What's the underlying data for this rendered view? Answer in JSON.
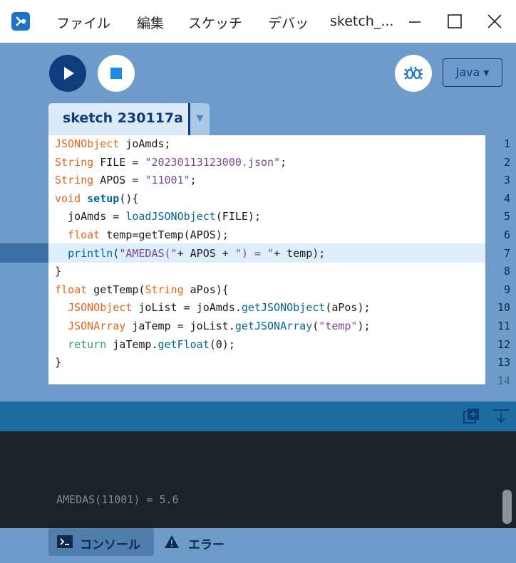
{
  "menu": [
    "ファイル",
    "編集",
    "スケッチ",
    "デバッ"
  ],
  "window_title": "sketch_...",
  "toolbar": {
    "mode_label": "Java ▾"
  },
  "tab": {
    "label": "sketch 230117a",
    "arrow": "▼"
  },
  "editor": {
    "active_line": 7,
    "line_numbers": [
      "1",
      "2",
      "3",
      "4",
      "5",
      "6",
      "7",
      "8",
      "9",
      "10",
      "11",
      "12",
      "13",
      "14"
    ]
  },
  "console": {
    "output": "AMEDAS(11001) = 5.6"
  },
  "footer": {
    "console_tab": "コンソール",
    "error_tab": "エラー"
  },
  "colors": {
    "accent": "#0d3d7c",
    "toolbar_bg": "#6d9ccb",
    "console_bg": "#1b2329",
    "console_header": "#1c6ca1"
  },
  "icons": [
    "app-icon",
    "minimize-icon",
    "maximize-icon",
    "close-icon",
    "run-icon",
    "stop-icon",
    "debug-icon",
    "add-window-icon",
    "scroll-down-icon",
    "console-icon",
    "warning-icon"
  ]
}
